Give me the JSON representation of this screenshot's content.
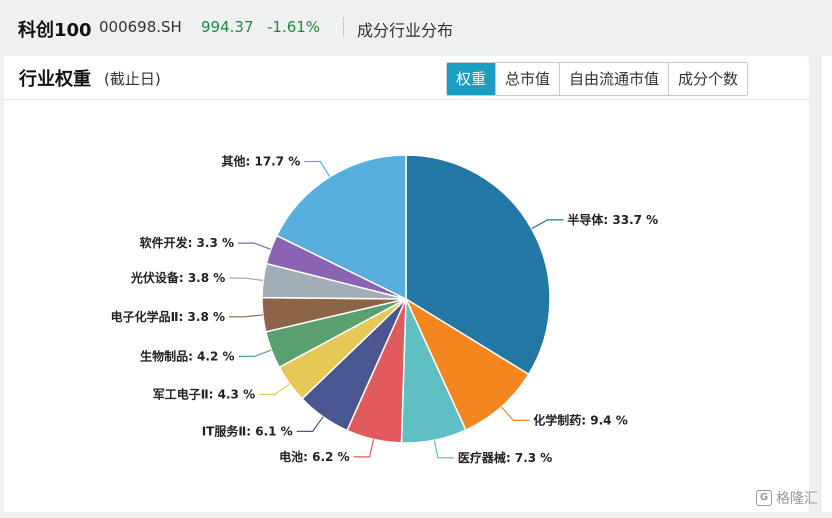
{
  "header": {
    "index_name": "科创100",
    "index_code": "000698.SH",
    "price": "994.37",
    "change": "-1.61%",
    "page_title": "成分行业分布"
  },
  "card": {
    "title": "行业权重",
    "subtitle": "(截止日)",
    "tabs": [
      "权重",
      "总市值",
      "自由流通市值",
      "成分个数"
    ],
    "active_tab": 0
  },
  "watermark": {
    "icon": "G",
    "text": "格隆汇"
  },
  "colors": {
    "accent": "#1a9ec4",
    "change_down": "#1e8a3c"
  },
  "chart_data": {
    "type": "pie",
    "unit": "%",
    "slices": [
      {
        "name": "半导体",
        "value": 33.7,
        "color": "#2277a4"
      },
      {
        "name": "化学制药",
        "value": 9.4,
        "color": "#f5861f"
      },
      {
        "name": "医疗器械",
        "value": 7.3,
        "color": "#5fbfc2"
      },
      {
        "name": "电池",
        "value": 6.2,
        "color": "#e05a5e"
      },
      {
        "name": "IT服务Ⅱ",
        "value": 6.1,
        "color": "#4a568f"
      },
      {
        "name": "军工电子Ⅱ",
        "value": 4.3,
        "color": "#e5c855"
      },
      {
        "name": "生物制品",
        "value": 4.2,
        "color": "#5aa06e"
      },
      {
        "name": "电子化学品Ⅱ",
        "value": 3.8,
        "color": "#8c6549"
      },
      {
        "name": "光伏设备",
        "value": 3.8,
        "color": "#a3adb6"
      },
      {
        "name": "软件开发",
        "value": 3.3,
        "color": "#8a64b2"
      },
      {
        "name": "其他",
        "value": 17.7,
        "color": "#56afdf"
      }
    ]
  }
}
